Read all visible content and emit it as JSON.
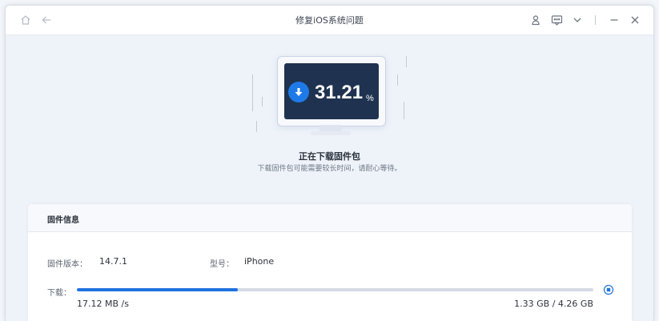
{
  "window": {
    "title": "修复iOS系统问题"
  },
  "titlebar": {
    "icons": [
      "home-icon",
      "back-arrow-icon",
      "user-icon",
      "feedback-icon",
      "chevron-down-icon",
      "minimize-icon",
      "close-icon"
    ]
  },
  "progress": {
    "value": "31.21",
    "unit": "%",
    "heading": "正在下载固件包",
    "subtext": "下载固件包可能需要较长时间，请耐心等待。"
  },
  "firmware": {
    "section_title": "固件信息",
    "version_label": "固件版本：",
    "version_value": "14.7.1",
    "model_label": "型号：",
    "model_value": "iPhone",
    "download_label": "下载：",
    "speed": "17.12 MB /s",
    "size_progress": "1.33 GB / 4.26 GB",
    "progress_fraction": 0.3121
  },
  "colors": {
    "accent": "#1f72e0",
    "screen": "#1f3350",
    "track": "#d5dbe5"
  }
}
